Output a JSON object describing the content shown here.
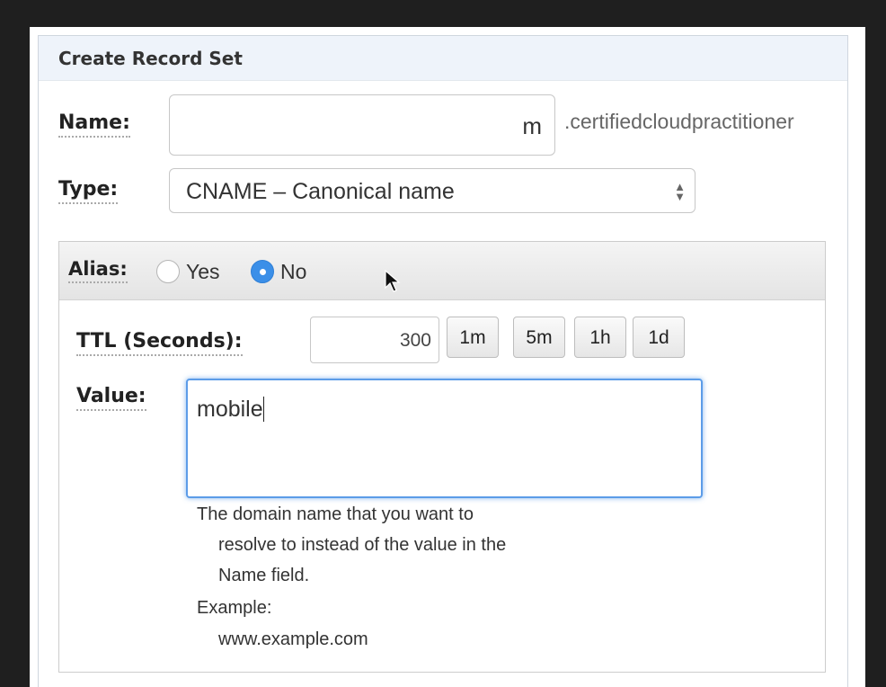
{
  "panel": {
    "title": "Create Record Set"
  },
  "name": {
    "label": "Name:",
    "value": "m",
    "suffix": ".certifiedcloudpractitioner"
  },
  "type": {
    "label": "Type:",
    "selected": "CNAME – Canonical name"
  },
  "alias": {
    "label": "Alias:",
    "yes_label": "Yes",
    "no_label": "No",
    "selected": "No"
  },
  "ttl": {
    "label": "TTL (Seconds):",
    "value": "300",
    "presets": [
      "1m",
      "5m",
      "1h",
      "1d"
    ]
  },
  "value": {
    "label": "Value:",
    "text": "mobile",
    "help_lines": [
      "The domain name that you want to",
      "resolve to instead of the value in the",
      "Name field."
    ],
    "example_label": "Example:",
    "example_value": "www.example.com"
  },
  "colors": {
    "accent": "#3b8fe8",
    "focus_border": "#5c9ce8"
  },
  "icons": {
    "select": "updown-arrows-icon",
    "cursor": "mouse-pointer-icon"
  }
}
